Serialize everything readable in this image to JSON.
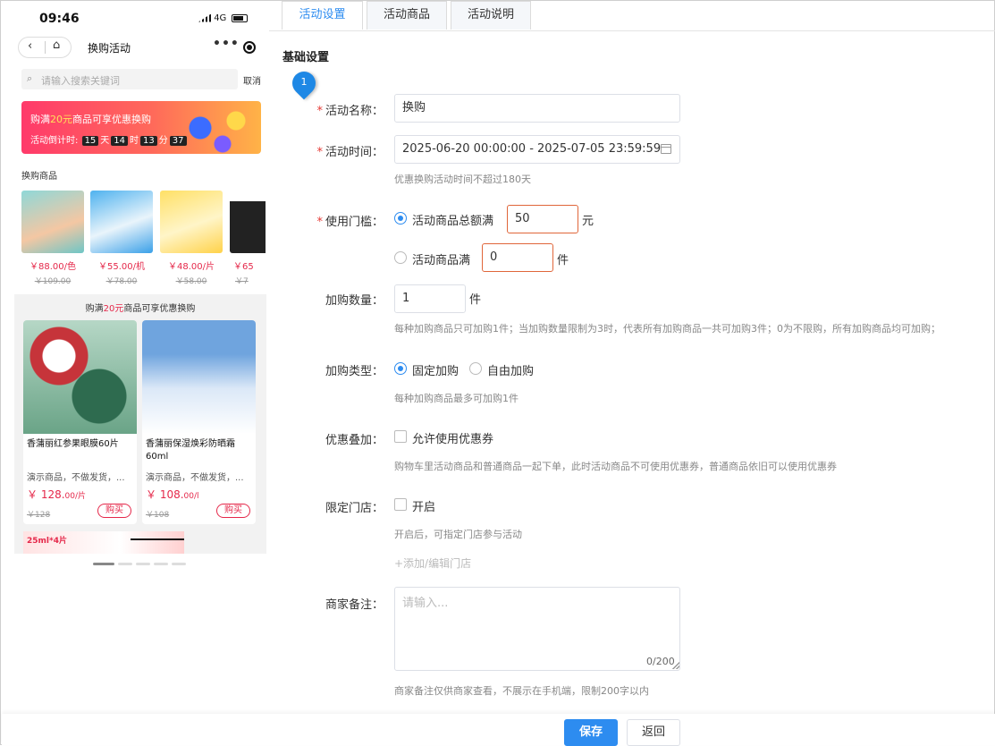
{
  "phone": {
    "status": {
      "time": "09:46",
      "network": "4G"
    },
    "nav": {
      "back": "‹",
      "home": "⌂",
      "title": "换购活动",
      "more": "•••"
    },
    "search": {
      "placeholder": "请输入搜索关键词",
      "cancel": "取消"
    },
    "banner": {
      "pre": "购满",
      "amount": "20元",
      "post": "商品可享优惠换购",
      "countdown_label": "活动倒计时:",
      "days": "15",
      "day_unit": "天",
      "hours": "14",
      "hour_unit": "时",
      "minutes": "13",
      "minute_unit": "分",
      "seconds": "37"
    },
    "section_title": "换购商品",
    "exchange_products": [
      {
        "price": "￥88.00/色",
        "orig": "￥109.00",
        "color": "#6ec6c6"
      },
      {
        "price": "￥55.00/机",
        "orig": "￥78.00",
        "color": "#3aa0e8"
      },
      {
        "price": "￥48.00/片",
        "orig": "￥58.00",
        "color": "#ffd24a"
      },
      {
        "price": "￥65",
        "orig": "￥7",
        "color": "#222222"
      }
    ],
    "promo_title": {
      "pre": "购满",
      "amount": "20元",
      "post": "商品可享优惠换购"
    },
    "products": [
      {
        "name": "香蒲丽红参果眼膜60片",
        "desc": "演示商品，不做发货，...",
        "price": "￥ 128.",
        "cents": "00/片",
        "orig": "￥128",
        "buy": "购买",
        "color": "#4d9b7a"
      },
      {
        "name": "香蒲丽保湿焕彩防晒霜60ml",
        "desc": "演示商品，不做发货，...",
        "price": "￥ 108.",
        "cents": "00/l",
        "orig": "￥108",
        "buy": "购买",
        "color": "#a9c8ec"
      }
    ],
    "peek_text": "25ml*4片"
  },
  "tabs": [
    {
      "label": "活动设置",
      "active": true
    },
    {
      "label": "活动商品",
      "active": false
    },
    {
      "label": "活动说明",
      "active": false
    }
  ],
  "form": {
    "section_title": "基础设置",
    "marker_number": "1",
    "required_mark": "*",
    "name": {
      "label": "活动名称：",
      "value": "换购"
    },
    "time": {
      "label": "活动时间：",
      "value": "2025-06-20 00:00:00 - 2025-07-05 23:59:59",
      "hint": "优惠换购活动时间不超过180天"
    },
    "threshold": {
      "label": "使用门槛：",
      "option1": "活动商品总额满",
      "value1": "50",
      "unit1": "元",
      "option2": "活动商品满",
      "value2": "0",
      "unit2": "件"
    },
    "quantity": {
      "label": "加购数量：",
      "value": "1",
      "unit": "件",
      "hint": "每种加购商品只可加购1件；当加购数量限制为3时，代表所有加购商品一共可加购3件；0为不限购，所有加购商品均可加购；"
    },
    "type": {
      "label": "加购类型：",
      "option1": "固定加购",
      "option2": "自由加购",
      "hint": "每种加购商品最多可加购1件"
    },
    "stack": {
      "label": "优惠叠加：",
      "option": "允许使用优惠券",
      "hint": "购物车里活动商品和普通商品一起下单，此时活动商品不可使用优惠券，普通商品依旧可以使用优惠券"
    },
    "store": {
      "label": "限定门店：",
      "option": "开启",
      "hint": "开启后，可指定门店参与活动",
      "link": "+添加/编辑门店"
    },
    "remark": {
      "label": "商家备注：",
      "placeholder": "请输入...",
      "counter": "0/200",
      "hint": "商家备注仅供商家查看，不展示在手机端，限制200字以内"
    }
  },
  "footer": {
    "save": "保存",
    "back": "返回"
  },
  "colors": {
    "primary": "#2d8cf0",
    "required": "#e53935",
    "price": "#e5284a",
    "error_border": "#e0663a"
  }
}
